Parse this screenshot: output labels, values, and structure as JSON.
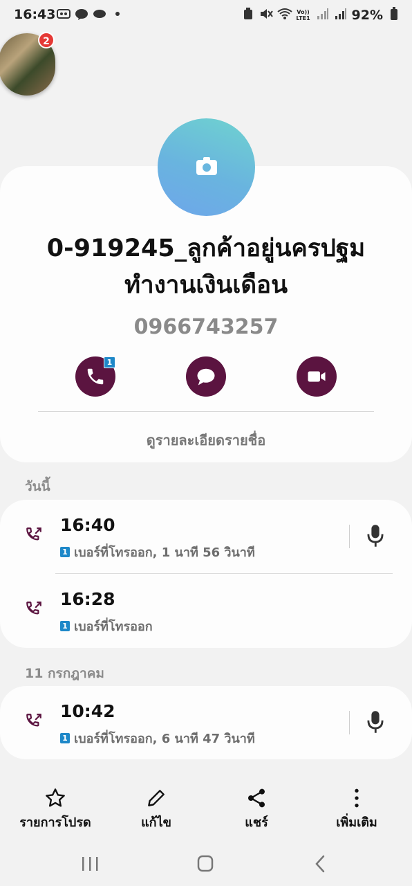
{
  "status_bar": {
    "time": "16:43",
    "left_icons": [
      "voicemail-icon",
      "line-icon",
      "chat-icon",
      "dot-icon"
    ],
    "right_icons": [
      "battery-saver-icon",
      "mute-icon",
      "wifi-icon",
      "volte-icon",
      "signal-icon",
      "signal-icon"
    ],
    "network_label": "Vo)) LTE1",
    "battery": "92%"
  },
  "floating_bubble": {
    "badge_count": "2"
  },
  "contact": {
    "name": "0-919245_ลูกค้าอยู่นครปฐมทำงานเงินเดือน",
    "phone": "0966743257",
    "call_sim_badge": "1",
    "view_details_label": "ดูรายละเอียดรายชื่อ",
    "accent_color": "#5b1440"
  },
  "call_log": {
    "sections": [
      {
        "label": "วันนี้",
        "entries": [
          {
            "time": "16:40",
            "sim": "1",
            "description": "เบอร์ที่โทรออก, 1 นาที 56 วินาที",
            "has_recording": true
          },
          {
            "time": "16:28",
            "sim": "1",
            "description": "เบอร์ที่โทรออก",
            "has_recording": false
          }
        ]
      },
      {
        "label": "11 กรกฎาคม",
        "entries": [
          {
            "time": "10:42",
            "sim": "1",
            "description": "เบอร์ที่โทรออก, 6 นาที 47 วินาที",
            "has_recording": true
          }
        ]
      }
    ]
  },
  "toolbar": {
    "favorites_label": "รายการโปรด",
    "edit_label": "แก้ไข",
    "share_label": "แชร์",
    "more_label": "เพิ่มเติม"
  }
}
